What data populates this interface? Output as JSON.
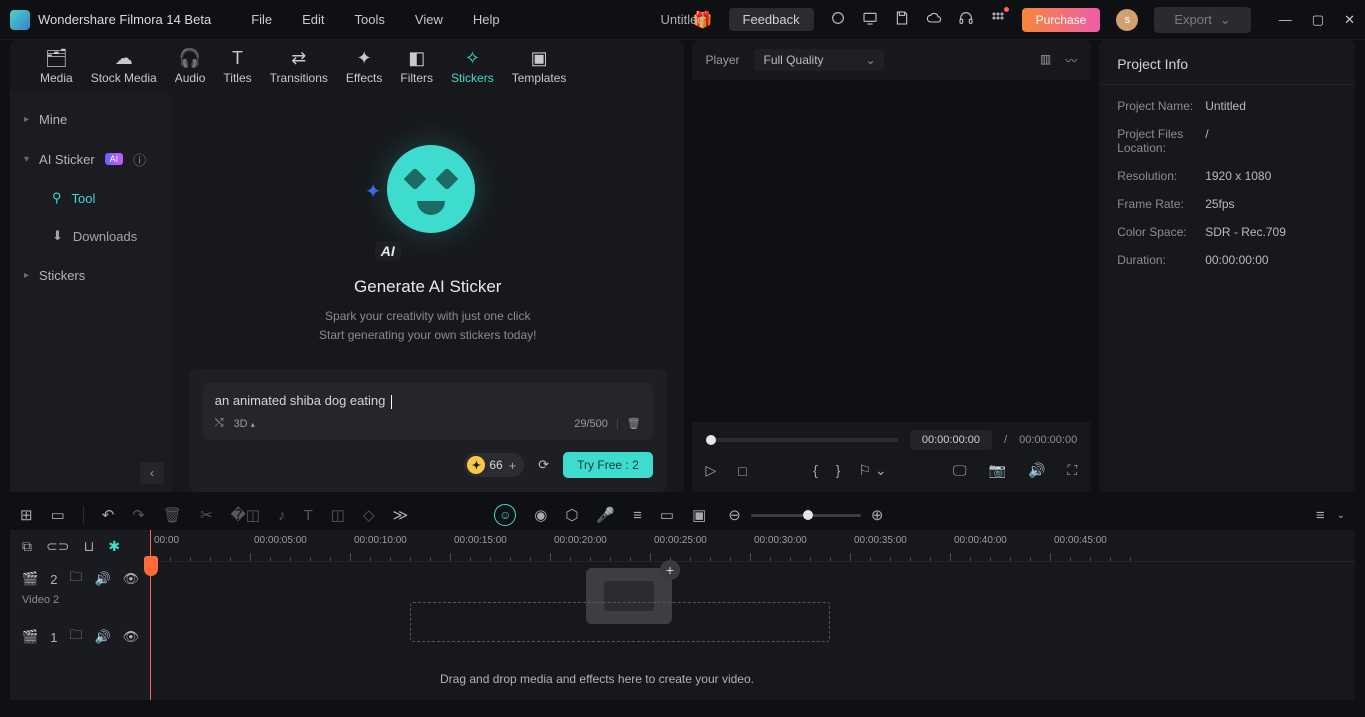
{
  "titlebar": {
    "app_name": "Wondershare Filmora 14 Beta",
    "menu": [
      "File",
      "Edit",
      "Tools",
      "View",
      "Help"
    ],
    "doc_title": "Untitled",
    "feedback": "Feedback",
    "purchase": "Purchase",
    "avatar_letter": "s",
    "export": "Export"
  },
  "tabs": {
    "items": [
      {
        "label": "Media"
      },
      {
        "label": "Stock Media"
      },
      {
        "label": "Audio"
      },
      {
        "label": "Titles"
      },
      {
        "label": "Transitions"
      },
      {
        "label": "Effects"
      },
      {
        "label": "Filters"
      },
      {
        "label": "Stickers"
      },
      {
        "label": "Templates"
      }
    ]
  },
  "sidebar": {
    "mine": "Mine",
    "ai_sticker": "AI Sticker",
    "ai_badge": "AI",
    "tool": "Tool",
    "downloads": "Downloads",
    "stickers": "Stickers"
  },
  "hero": {
    "title": "Generate AI Sticker",
    "sub1": "Spark your creativity with just one click",
    "sub2": "Start generating your own stickers today!",
    "ai_chip": "AI"
  },
  "prompt": {
    "text": "an animated shiba dog eating ",
    "mode": "3D",
    "counter": "29/500",
    "credits": "66",
    "try": "Try Free : 2"
  },
  "player": {
    "label": "Player",
    "quality": "Full Quality",
    "time": "00:00:00:00",
    "duration": "00:00:00:00",
    "sep": "/"
  },
  "info": {
    "title": "Project Info",
    "rows": [
      {
        "label": "Project Name:",
        "value": "Untitled"
      },
      {
        "label": "Project Files Location:",
        "value": "/"
      },
      {
        "label": "Resolution:",
        "value": "1920 x 1080"
      },
      {
        "label": "Frame Rate:",
        "value": "25fps"
      },
      {
        "label": "Color Space:",
        "value": "SDR - Rec.709"
      },
      {
        "label": "Duration:",
        "value": "00:00:00:00"
      }
    ]
  },
  "timeline": {
    "ruler": [
      "00:00",
      "00:00:05:00",
      "00:00:10:00",
      "00:00:15:00",
      "00:00:20:00",
      "00:00:25:00",
      "00:00:30:00",
      "00:00:35:00",
      "00:00:40:00",
      "00:00:45:00"
    ],
    "track2_num": "2",
    "track2_label": "Video 2",
    "track1_num": "1",
    "drop_text": "Drag and drop media and effects here to create your video."
  }
}
